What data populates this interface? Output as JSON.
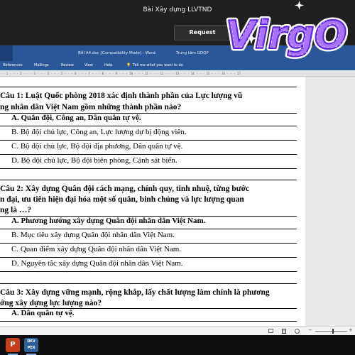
{
  "window": {
    "title": "Bài Xây dựng LLVTND",
    "request_button": "Request"
  },
  "word": {
    "title": "BÀI A4.doc [Compatibility Mode] - Word",
    "user": "Trung tâm GDQP",
    "tabs": [
      "References",
      "Mailings",
      "Review",
      "View",
      "Help"
    ],
    "tell_me": "Tell me what you want to do",
    "tell_me_icon": "lightbulb-icon"
  },
  "logo": {
    "text": "VirgO",
    "colors": [
      "#c8a0ff",
      "#7a3cff",
      "#ffffff"
    ]
  },
  "document": {
    "questions": [
      {
        "lines": [
          "     Câu 1: Luật Quốc phòng 2018 xác định thành phần của Lực lượng vũ",
          "ng nhân dân Việt Nam gồm những thành phần nào?"
        ],
        "options": [
          {
            "text": "A. Quân đội, Công an, Dân quân tự vệ.",
            "bold": true
          },
          {
            "text": "B. Bộ đội chủ lực, Công an, Lực lượng dự bị động viên.",
            "bold": false
          },
          {
            "text": "C. Bộ đội chủ lực, Bộ đội địa phương, Dân quân tự vệ.",
            "bold": false
          },
          {
            "text": "D. Bộ đội chủ lực, Bộ đội biên phòng, Cảnh sát biển.",
            "bold": false
          }
        ]
      },
      {
        "lines": [
          "     Câu 2: Xây dựng Quân đội cách mạng, chính quy, tinh nhuệ, từng bước",
          "n đại, ưu tiên hiện đại hóa một số quân, binh chủng và lực lượng quan",
          "ng là …?"
        ],
        "options": [
          {
            "text": "A. Phương hướng xây dựng Quân đội nhân dân Việt Nam.",
            "bold": true
          },
          {
            "text": "B. Mục tiêu xây dựng Quân đội nhân dân Việt Nam.",
            "bold": false
          },
          {
            "text": "C. Quan điểm xây dựng Quân đội nhân dân Việt Nam.",
            "bold": false
          },
          {
            "text": "D. Nguyên tắc xây dựng Quân đội nhân dân Việt Nam.",
            "bold": false
          }
        ]
      },
      {
        "lines": [
          "     Câu 3: Xây dựng vững mạnh, rộng khắp, lấy chất lượng làm chính là phương",
          "ớng xây dựng lực lượng nào?"
        ],
        "options": [
          {
            "text": "A. Dân quân tự vệ.",
            "bold": true
          }
        ]
      }
    ]
  },
  "statusbar": {
    "icons": [
      "read-mode-icon",
      "print-layout-icon",
      "web-layout-icon"
    ],
    "zoom_minus": "−",
    "zoom_plus": "+"
  },
  "taskbar": {
    "apps": [
      {
        "name": "powerpoint",
        "label": "P"
      },
      {
        "name": "dev",
        "label": "DEV\nPEX"
      }
    ]
  }
}
